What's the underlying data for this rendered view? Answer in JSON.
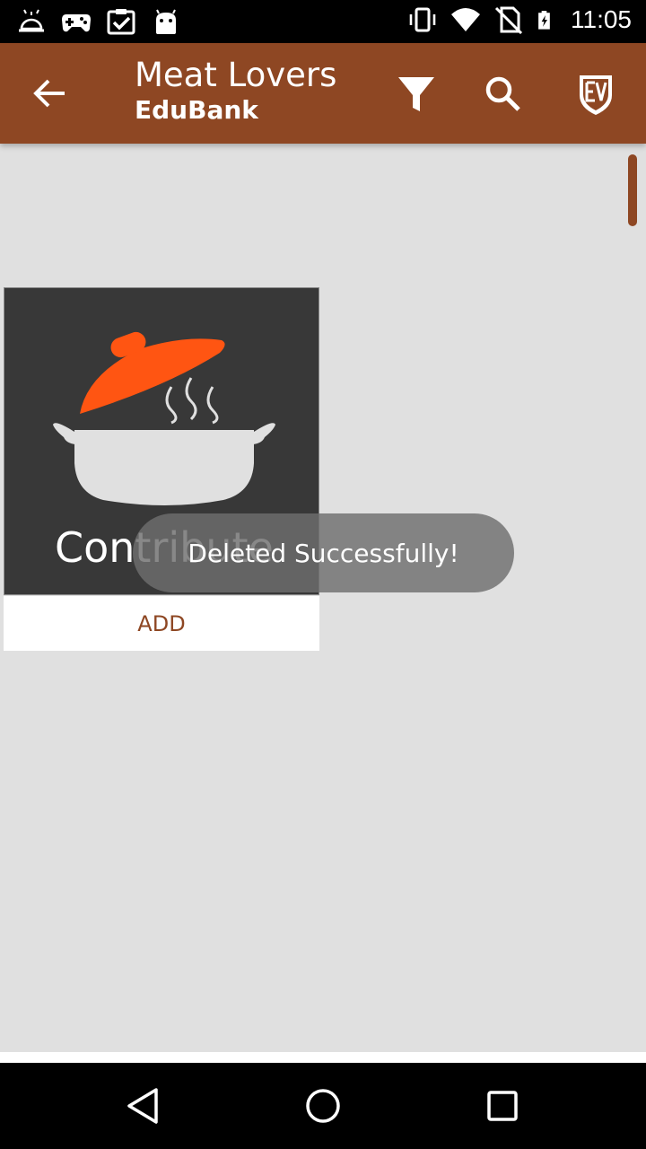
{
  "status_bar": {
    "time": "11:05",
    "icons": [
      "room-service-icon",
      "gamepad-icon",
      "clipboard-check-icon",
      "android-icon",
      "vibrate-icon",
      "wifi-icon",
      "no-sim-icon",
      "battery-charging-icon"
    ]
  },
  "app_bar": {
    "title": "Meat Lovers",
    "subtitle": "EduBank",
    "actions": [
      "back-arrow-icon",
      "filter-icon",
      "search-icon",
      "ev-logo-icon"
    ],
    "color": "#8e4723"
  },
  "card": {
    "label": "Contribute",
    "add_label": "ADD",
    "lid_color": "#ff5512",
    "background": "#383838"
  },
  "toast": {
    "message": "Deleted Successfully!"
  },
  "nav_bar": {
    "buttons": [
      "back-triangle-icon",
      "home-circle-icon",
      "recents-square-icon"
    ]
  }
}
